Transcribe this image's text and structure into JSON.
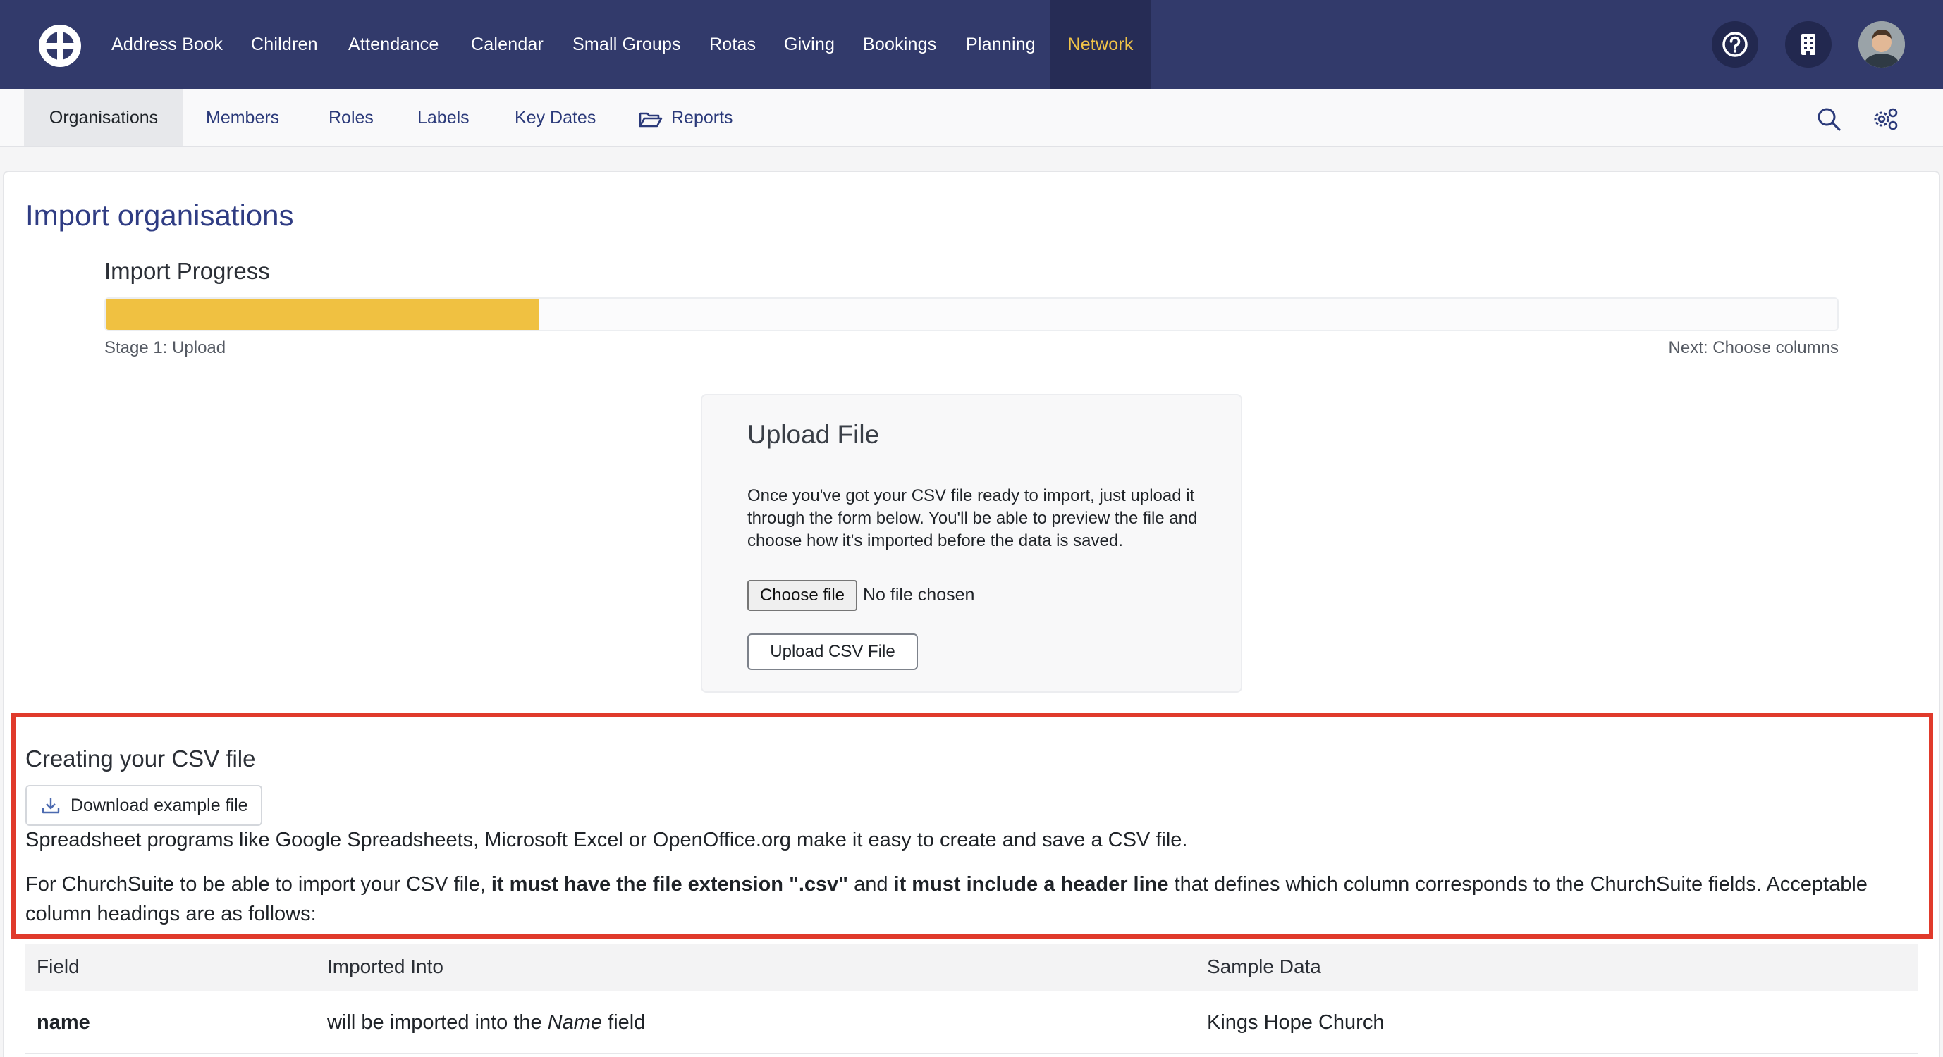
{
  "topnav": {
    "items": [
      {
        "label": "Address Book"
      },
      {
        "label": "Children"
      },
      {
        "label": "Attendance"
      },
      {
        "label": "Calendar"
      },
      {
        "label": "Small Groups"
      },
      {
        "label": "Rotas"
      },
      {
        "label": "Giving"
      },
      {
        "label": "Bookings"
      },
      {
        "label": "Planning"
      },
      {
        "label": "Network",
        "active": true
      }
    ],
    "icons": [
      "help-icon",
      "building-icon",
      "avatar"
    ],
    "colors": {
      "background": "#323a6b",
      "active_text": "#f0c348"
    }
  },
  "subnav": {
    "items": [
      {
        "label": "Organisations",
        "active": true
      },
      {
        "label": "Members"
      },
      {
        "label": "Roles"
      },
      {
        "label": "Labels"
      },
      {
        "label": "Key Dates"
      },
      {
        "label": "Reports",
        "icon": "folder-open-icon"
      }
    ],
    "icons": [
      "search-icon",
      "settings-gears-icon"
    ]
  },
  "page": {
    "title": "Import organisations",
    "progress": {
      "label": "Import Progress",
      "fraction": 0.25,
      "stage": "Stage 1: Upload",
      "next": "Next: Choose columns",
      "color": "#f0c141"
    },
    "upload": {
      "title": "Upload File",
      "description": "Once you've got your CSV file ready to import, just upload it through the form below. You'll be able to preview the file and choose how it's imported before the data is saved.",
      "choose_button": "Choose file",
      "no_file": "No file chosen",
      "upload_button": "Upload CSV File"
    },
    "csv": {
      "heading": "Creating your CSV file",
      "download_button": "Download example file",
      "para1": "Spreadsheet programs like Google Spreadsheets, Microsoft Excel or OpenOffice.org make it easy to create and save a CSV file.",
      "para2_a": "For ChurchSuite to be able to import your CSV file, ",
      "para2_b": "it must have the file extension \".csv\"",
      "para2_c": " and ",
      "para2_d": "it must include a header line",
      "para2_e": " that defines which column corresponds to the ChurchSuite fields. Acceptable column headings are as follows:",
      "highlight_color": "#e03a2b"
    },
    "table": {
      "headers": [
        "Field",
        "Imported Into",
        "Sample Data"
      ],
      "rows": [
        {
          "field": "name",
          "into_a": "will be imported into the ",
          "into_b": "Name",
          "into_c": " field",
          "sample": "Kings Hope Church"
        }
      ]
    }
  }
}
